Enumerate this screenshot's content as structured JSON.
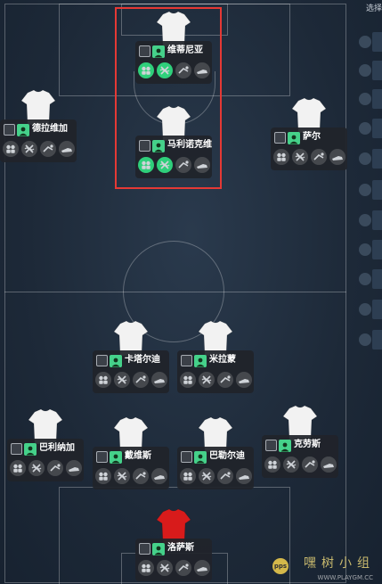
{
  "sidebar": {
    "title": "选择"
  },
  "players": [
    {
      "key": "top",
      "name": "维蒂尼亚",
      "kit": "white",
      "active": true
    },
    {
      "key": "mid",
      "name": "马利诺克维",
      "kit": "white",
      "active": true
    },
    {
      "key": "lw",
      "name": "德拉维加",
      "kit": "white",
      "active": false
    },
    {
      "key": "rw",
      "name": "萨尔",
      "kit": "white",
      "active": false
    },
    {
      "key": "cm1",
      "name": "卡塔尔迪",
      "kit": "white",
      "active": false
    },
    {
      "key": "cm2",
      "name": "米拉蒙",
      "kit": "white",
      "active": false
    },
    {
      "key": "lb",
      "name": "巴利纳加",
      "kit": "white",
      "active": false
    },
    {
      "key": "cb1",
      "name": "戴维斯",
      "kit": "white",
      "active": false
    },
    {
      "key": "cb2",
      "name": "巴勒尔迪",
      "kit": "white",
      "active": false
    },
    {
      "key": "rb",
      "name": "克劳斯",
      "kit": "white",
      "active": false
    },
    {
      "key": "gk",
      "name": "洛萨斯",
      "kit": "red",
      "active": false
    }
  ],
  "icons": [
    "team-icon",
    "cross-arrows-icon",
    "sliding-tackle-icon",
    "boot-icon"
  ],
  "colors": {
    "accent": "#2fcf7b",
    "select_border": "#e53935",
    "gk_kit": "#d81b1b",
    "field_kit": "#f2f2f2"
  },
  "watermark": {
    "text": "嘿树小组",
    "url": "WWW.PLAYGM.CC",
    "logo": "pps"
  }
}
